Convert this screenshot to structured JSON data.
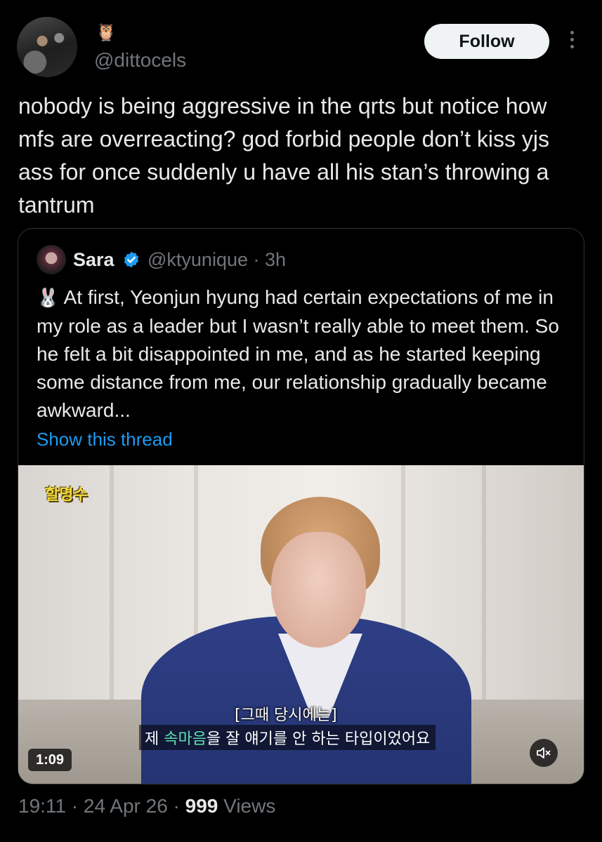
{
  "author": {
    "name_emoji": "🦉",
    "handle": "@dittocels"
  },
  "follow_button": {
    "label": "Follow"
  },
  "tweet": {
    "text": "nobody is being aggressive in the qrts but notice how mfs are overreacting? god forbid people don’t kiss yjs ass for once suddenly u have all his stan’s throwing a tantrum"
  },
  "quoted_tweet": {
    "name": "Sara",
    "handle": "@ktyunique",
    "time_sep": "·",
    "time": "3h",
    "emoji": "🐰",
    "text": "At first, Yeonjun hyung had certain expectations of me in my role as a leader but I wasn’t really able to meet them. So he felt a bit disappointed in me, and as he started keeping some distance from me, our relationship gradually became awkward...",
    "show_thread": "Show this thread",
    "video": {
      "show_logo": "할명수",
      "subtitle_top": "[그때 당시에는]",
      "subtitle_pre": "제 ",
      "subtitle_highlight": "속마음",
      "subtitle_post": "을 잘 얘기를 안 하는 타입이었어요",
      "duration": "1:09"
    }
  },
  "meta": {
    "time": "19:11",
    "date": "24 Apr 26",
    "sep": "·",
    "views_count": "999",
    "views_label": "Views"
  },
  "colors": {
    "background": "#000000",
    "text": "#e7e9ea",
    "secondary": "#71767b",
    "link": "#1d9bf0",
    "verified": "#1d9bf0"
  },
  "icons": [
    "more-vertical-icon",
    "verified-badge-icon",
    "mute-icon"
  ]
}
